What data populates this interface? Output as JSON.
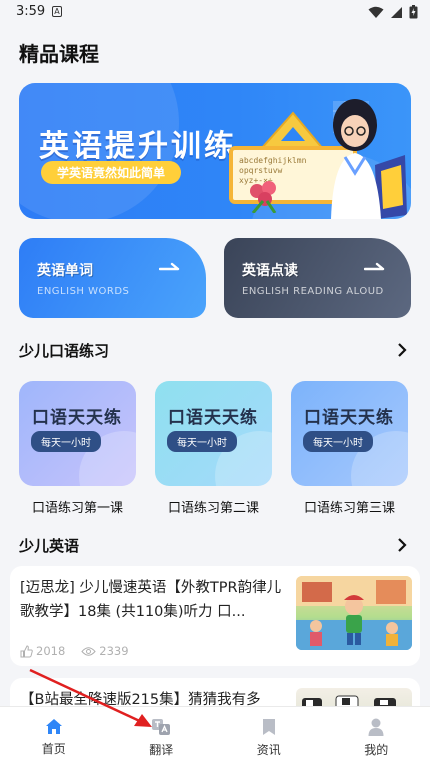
{
  "status_bar": {
    "time": "3:59",
    "notif": "A"
  },
  "page_title": "精品课程",
  "banner": {
    "title": "英语提升训练",
    "subtitle": "学英语竟然如此简单",
    "board_text": "abcdefghijklmn\nopqrstuvw\nxyz+-×÷"
  },
  "cards": [
    {
      "title": "英语单词",
      "subtitle": "ENGLISH WORDS"
    },
    {
      "title": "英语点读",
      "subtitle": "ENGLISH READING ALOUD"
    }
  ],
  "section_oral": {
    "title": "少儿口语练习",
    "tiles": [
      {
        "title": "口语天天练",
        "badge": "每天一小时",
        "label": "口语练习第一课"
      },
      {
        "title": "口语天天练",
        "badge": "每天一小时",
        "label": "口语练习第二课"
      },
      {
        "title": "口语天天练",
        "badge": "每天一小时",
        "label": "口语练习第三课"
      }
    ]
  },
  "section_english": {
    "title": "少儿英语",
    "videos": [
      {
        "title": "[迈思龙] 少儿慢速英语【外教TPR韵律儿歌教学】18集 (共110集)听力 口...",
        "likes": "2018",
        "views": "2339"
      },
      {
        "title": "【B站最全降速版215集】猜猜我有多",
        "likes": "",
        "views": ""
      }
    ]
  },
  "tabbar": [
    {
      "label": "首页",
      "icon": "home-icon",
      "active": true
    },
    {
      "label": "翻译",
      "icon": "translate-icon",
      "active": false
    },
    {
      "label": "资讯",
      "icon": "news-icon",
      "active": false
    },
    {
      "label": "我的",
      "icon": "profile-icon",
      "active": false
    }
  ],
  "colors": {
    "accent": "#2f86f7",
    "tab_active": "#2f86f7",
    "tab_inactive": "#b9bdc6",
    "annotation": "#e02020"
  }
}
